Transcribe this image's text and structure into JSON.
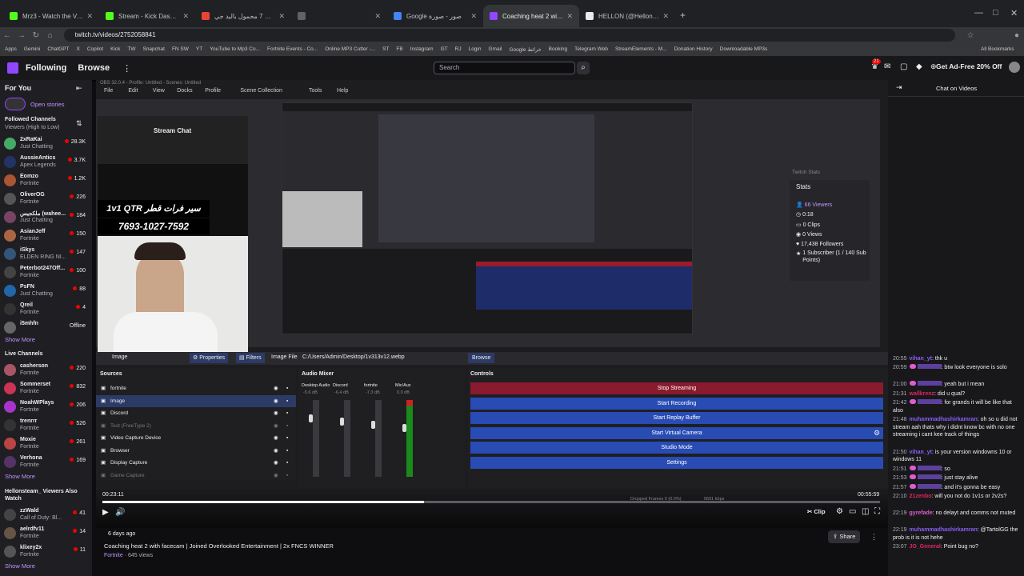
{
  "browser": {
    "tabs": [
      {
        "title": "Mrz3 - Watch the VOD on Kick",
        "color": "#53fc18"
      },
      {
        "title": "Stream - Kick Dashboard",
        "color": "#53fc18"
      },
      {
        "title": "اوسمو موبايل 7 محمول باليد جي...",
        "color": "#ea4335"
      },
      {
        "title": "",
        "color": "#5f6368"
      },
      {
        "title": "Google صور - صورة",
        "color": "#4285f4"
      },
      {
        "title": "Coaching heat 2 with facec",
        "color": "#9146ff",
        "active": true
      },
      {
        "title": "HELLON (@Hellonsteam) / X",
        "color": "#e8eaed"
      }
    ],
    "url": "twitch.tv/videos/2752058841",
    "bookmarks": [
      "Apps",
      "Gemini",
      "ChatGPT",
      "X",
      "Copilot",
      "Kick",
      "TW",
      "Snapchat",
      "FN SW",
      "YT",
      "YouTube to Mp3 Co...",
      "Fortnite Events - Co...",
      "Online MP3 Cutter -...",
      "ST",
      "FB",
      "Instagram",
      "GT",
      "RJ",
      "Login",
      "Gmail",
      "Google خرائط",
      "Booking",
      "Telegram Web",
      "StreamElements - M...",
      "Donation History",
      "Downloadable MP3s"
    ],
    "all_bookmarks": "All Bookmarks"
  },
  "topnav": {
    "following": "Following",
    "browse": "Browse",
    "search_placeholder": "Search",
    "ad_free": "Get Ad-Free 20% Off",
    "notif_count": "21"
  },
  "sidebar": {
    "for_you": "For You",
    "open_stories": "Open stories",
    "followed_header": "Followed Channels",
    "followed_sort": "Viewers (High to Low)",
    "followed": [
      {
        "name": "2xRaKai",
        "game": "Just Chatting",
        "viewers": "28.3K",
        "color": "#4a6"
      },
      {
        "name": "AussieAntics",
        "game": "Apex Legends",
        "viewers": "3.7K",
        "color": "#236"
      },
      {
        "name": "Eomzo",
        "game": "Fortnite",
        "viewers": "1.2K",
        "color": "#a53"
      },
      {
        "name": "OliverOG",
        "game": "Fortnite",
        "viewers": "226",
        "color": "#555"
      },
      {
        "name": "ملكجيس (wahee...",
        "game": "Just Chatting",
        "viewers": "184",
        "color": "#746"
      },
      {
        "name": "AsianJeff",
        "game": "Fortnite",
        "viewers": "150",
        "color": "#a64"
      },
      {
        "name": "iSkys",
        "game": "ELDEN RING NI...",
        "viewers": "147",
        "color": "#357"
      },
      {
        "name": "Peterbot247Off...",
        "game": "Fortnite",
        "viewers": "100",
        "color": "#444"
      },
      {
        "name": "PsFN",
        "game": "Just Chatting",
        "viewers": "88",
        "color": "#26a"
      },
      {
        "name": "Qreil",
        "game": "Fortnite",
        "viewers": "4",
        "color": "#333"
      },
      {
        "name": "i5mhfn",
        "game": "",
        "viewers": "Offline",
        "color": "#666"
      }
    ],
    "show_more": "Show More",
    "live_header": "Live Channels",
    "live": [
      {
        "name": "casherson",
        "game": "Fortnite",
        "viewers": "220",
        "color": "#a56"
      },
      {
        "name": "Sommerset",
        "game": "Fortnite",
        "viewers": "832",
        "color": "#c35"
      },
      {
        "name": "NoahWPlays",
        "game": "Fortnite",
        "viewers": "206",
        "color": "#a3c"
      },
      {
        "name": "trenrrr",
        "game": "Fortnite",
        "viewers": "526",
        "color": "#333"
      },
      {
        "name": "Moxie",
        "game": "Fortnite",
        "viewers": "261",
        "color": "#b44"
      },
      {
        "name": "Verhona",
        "game": "Fortnite",
        "viewers": "169",
        "color": "#536"
      }
    ],
    "show_more2": "Show More",
    "also_header": "Hellonsteam_ Viewers Also Watch",
    "also": [
      {
        "name": "zzWald",
        "game": "Call of Duty: Bl...",
        "viewers": "41",
        "color": "#444"
      },
      {
        "name": "aelrdfv11",
        "game": "Fortnite",
        "viewers": "14",
        "color": "#654"
      },
      {
        "name": "klixey2x",
        "game": "Fortnite",
        "viewers": "11",
        "color": "#555"
      }
    ],
    "show_more3": "Show More"
  },
  "obs": {
    "title": "OBS 32.0.4 - Profile: Untitled - Scenes: Untitled",
    "menu": [
      "File",
      "Edit",
      "View",
      "Docks",
      "Profile",
      "Scene Collection",
      "Tools",
      "Help"
    ],
    "chat_title": "Stream Chat",
    "overlay_text": "سير فرات قطر",
    "overlay_code": "1v1 QTR",
    "overlay_number": "7693-1027-7592",
    "stats_title": "Twitch Stats",
    "stats": {
      "header": "Stats",
      "viewers": "66 Viewers",
      "time": "0:18",
      "clips": "0 Clips",
      "views": "0 Views",
      "followers": "17,438 Followers",
      "subs": "1 Subscriber (1 / 140 Sub Points)"
    },
    "props": {
      "image_label": "Image",
      "properties": "Properties",
      "filters": "Filters",
      "image_file": "Image File",
      "path": "C:/Users/Admin/Desktop/1v313v12.webp",
      "browse": "Browse"
    },
    "sources_title": "Sources",
    "sources": [
      "fortnite",
      "Image",
      "Discord",
      "Text (FreeType 2)",
      "Video Capture Device",
      "Browser",
      "Display Capture",
      "Game Capture"
    ],
    "mixer_title": "Audio Mixer",
    "mixer": [
      {
        "name": "Desktop Audio",
        "db": "-5.6 dB"
      },
      {
        "name": "Discord",
        "db": "-6.4 dB"
      },
      {
        "name": "fortnite",
        "db": "-7.3 dB"
      },
      {
        "name": "Mic/Aux",
        "db": "0.0 dB"
      }
    ],
    "controls_title": "Controls",
    "controls": [
      "Stop Streaming",
      "Start Recording",
      "Start Replay Buffer",
      "Start Virtual Camera",
      "Studio Mode",
      "Settings"
    ],
    "status_left": "Dropped Frames 0 (0.0%)",
    "status_kbps": "5691 kbps"
  },
  "player": {
    "elapsed": "00:23:11",
    "total": "00:55:59",
    "progress": 0.414,
    "clip": "Clip"
  },
  "video_info": {
    "age": "6 days ago",
    "title": "Coaching heat 2 with facecam | Joined Overlooked Entertainment | 2x FNCS WINNER",
    "game": "Fortnite",
    "views": "645 views",
    "share": "Share"
  },
  "chat": {
    "header": "Chat on Videos",
    "messages": [
      {
        "time": "20:55",
        "user": "vihan_yt",
        "color": "#8a5cf5",
        "text": ": thk u"
      },
      {
        "time": "20:59",
        "user": "",
        "color": "#8a5cf5",
        "text": ": btw look everyone is solo"
      },
      {
        "time": "21:00",
        "user": "",
        "color": "#8a5cf5",
        "text": ": yeah but i mean"
      },
      {
        "time": "21:31",
        "user": "wallkrenz",
        "color": "#e0245e",
        "text": ": did u qual?"
      },
      {
        "time": "21:42",
        "user": "",
        "color": "#8a5cf5",
        "text": ": for grands it will be like that also"
      },
      {
        "time": "21:48",
        "user": "muhammadhashirkamran",
        "color": "#8a5cf5",
        "text": ": oh so u did not stream aah thats why i didnt know bc with no one streaming i cant kee track of things"
      },
      {
        "time": "21:50",
        "user": "vihan_yt",
        "color": "#8a5cf5",
        "text": ": is your version windowns 10 or windows 11"
      },
      {
        "time": "21:51",
        "user": "",
        "color": "#8a5cf5",
        "text": ": so"
      },
      {
        "time": "21:53",
        "user": "",
        "color": "#8a5cf5",
        "text": ": just stay alive"
      },
      {
        "time": "21:57",
        "user": "",
        "color": "#8a5cf5",
        "text": ": and it's gonna be easy"
      },
      {
        "time": "22:10",
        "user": "21zenbo",
        "color": "#e0245e",
        "text": ": will you not do 1v1s or 2v2s?"
      },
      {
        "time": "22:19",
        "user": "gyrefade",
        "color": "#e05cd1",
        "text": ": no delayt and comms not muted"
      },
      {
        "time": "22:19",
        "user": "muhammadhashirkamran",
        "color": "#8a5cf5",
        "text": ": @TartolGG the prob is it is not hehe"
      },
      {
        "time": "23:07",
        "user": "JO_General",
        "color": "#e0245e",
        "text": ": Point bug no?"
      }
    ]
  }
}
